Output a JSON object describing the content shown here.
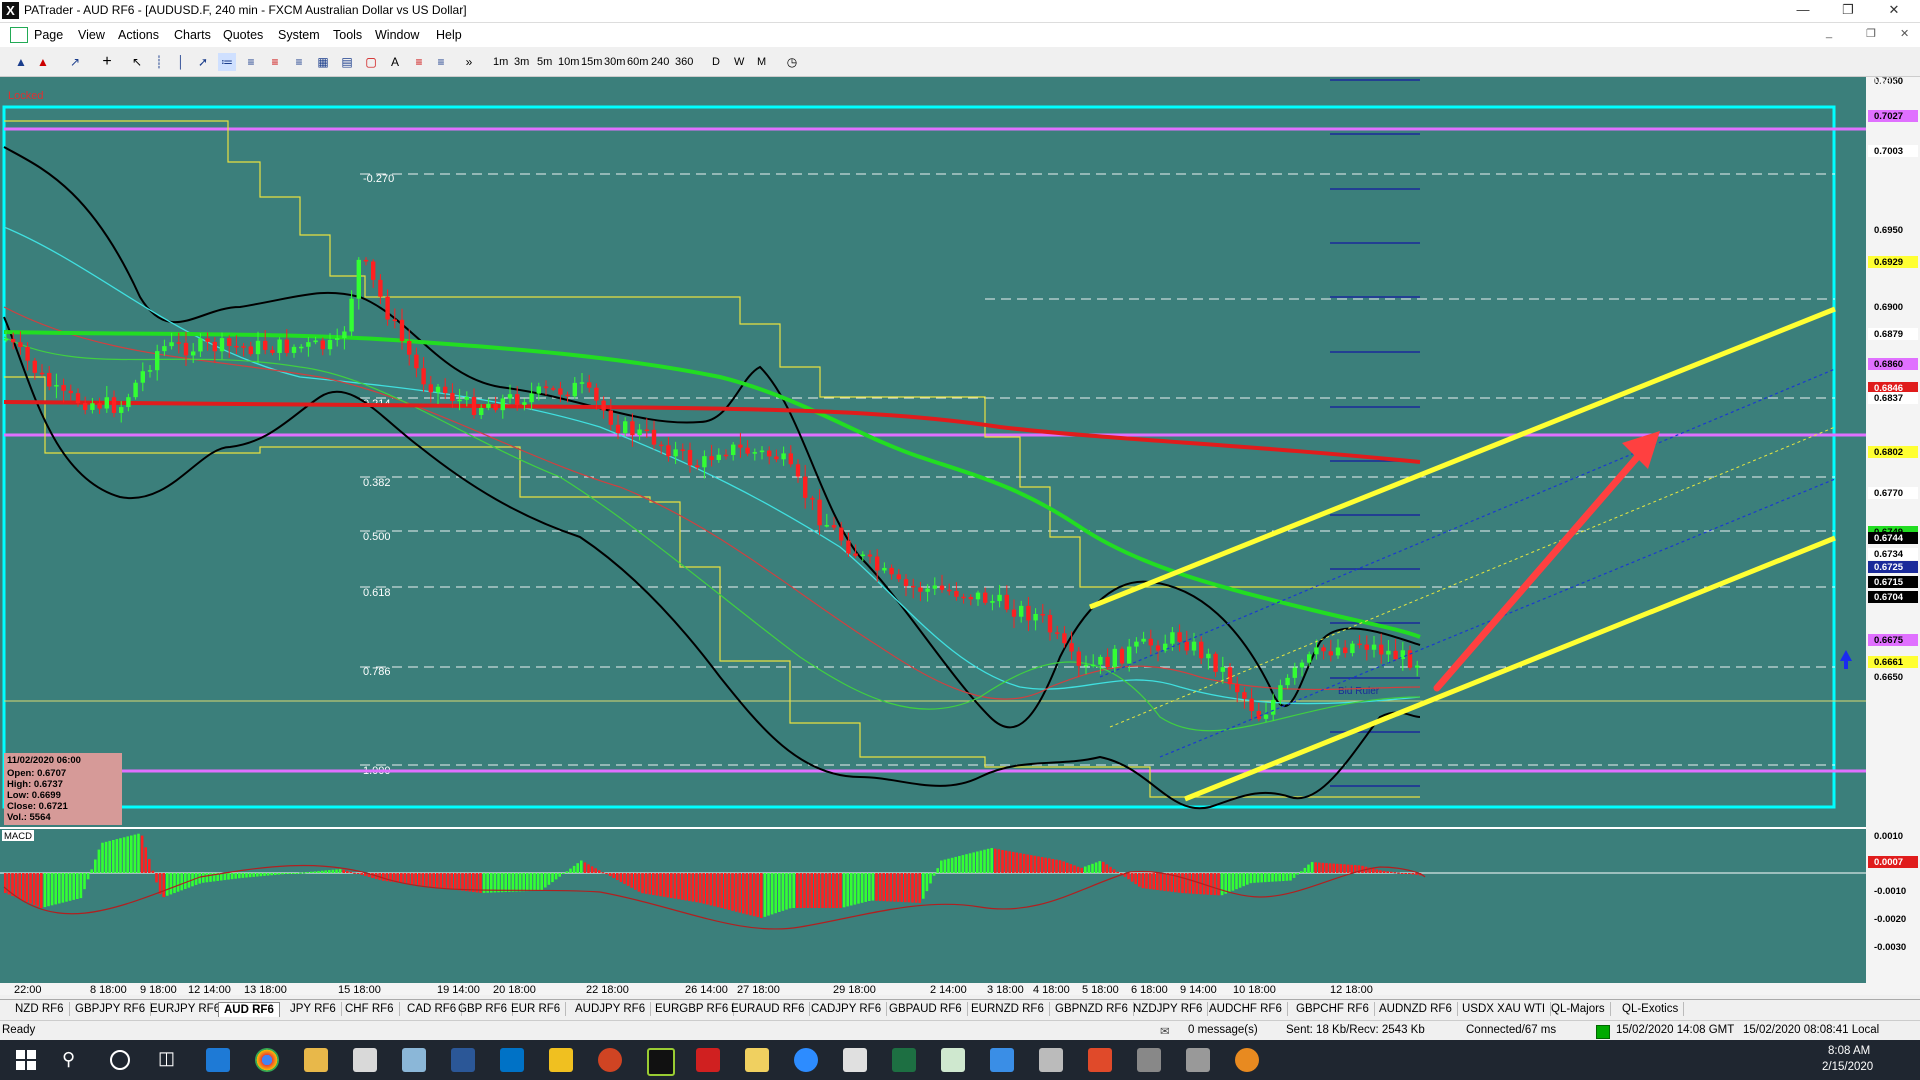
{
  "window": {
    "title": "PATrader - AUD RF6 - [AUDUSD.F, 240 min - FXCM Australian Dollar vs US Dollar]",
    "logo": "X"
  },
  "menu": [
    "Page",
    "View",
    "Actions",
    "Charts",
    "Quotes",
    "System",
    "Tools",
    "Window",
    "Help"
  ],
  "toolbar": {
    "timeframes": [
      "1m",
      "3m",
      "5m",
      "10m",
      "15m",
      "30m",
      "60m",
      "240",
      "360"
    ],
    "periods": [
      "D",
      "W",
      "M"
    ]
  },
  "chart": {
    "locked_label": "Locked",
    "index_label": "INDEX",
    "macd_label": "MACD",
    "fib_labels": [
      "-0.270",
      "0.214",
      "0.382",
      "0.500",
      "0.618",
      "0.786",
      "1.000"
    ],
    "price_labels": [
      "0.7050",
      "0.7027",
      "0.7003",
      "0.6950",
      "0.6929",
      "0.6900",
      "0.6879",
      "0.6860",
      "0.6846",
      "0.6837",
      "0.6802",
      "0.6770",
      "0.6749",
      "0.6744",
      "0.6734",
      "0.6725",
      "0.6715",
      "0.6704",
      "0.6675",
      "0.6661",
      "0.6650"
    ],
    "macd_labels": [
      "0.0010",
      "0.0007",
      "-0.0010",
      "-0.0020",
      "-0.0030"
    ],
    "time_labels": [
      "22:00",
      "8 18:00",
      "9 18:00",
      "12 14:00",
      "13 18:00",
      "15 18:00",
      "19 14:00",
      "20 18:00",
      "22 18:00",
      "26 14:00",
      "27 18:00",
      "29 18:00",
      "2 14:00",
      "3 18:00",
      "4 18:00",
      "5 18:00",
      "6 18:00",
      "9 14:00",
      "10 18:00",
      "12 18:00"
    ],
    "bid_label": "Bid Ruler",
    "ohlc": {
      "date": "11/02/2020 06:00",
      "open": "Open: 0.6707",
      "high": "High: 0.6737",
      "low": "Low: 0.6699",
      "close": "Close: 0.6721",
      "vol": "Vol.: 5564"
    },
    "colors": {
      "bg": "#3b7f7b",
      "bull": "#33ff33",
      "bear": "#ff2020",
      "cyan": "#00ffff",
      "magenta": "#e070ff",
      "yellow": "#ffff33",
      "red_arrow": "#ff4040"
    }
  },
  "tabs": [
    "NZD RF6",
    "GBPJPY RF6",
    "EURJPY RF6",
    "AUD RF6",
    "JPY RF6",
    "CHF RF6",
    "CAD RF6",
    "GBP RF6",
    "EUR RF6",
    "AUDJPY RF6",
    "EURGBP RF6",
    "EURAUD RF6",
    "CADJPY RF6",
    "GBPAUD RF6",
    "EURNZD RF6",
    "GBPNZD RF6",
    "NZDJPY RF6",
    "AUDCHF RF6",
    "GBPCHF RF6",
    "AUDNZD RF6",
    "USDX XAU WTI",
    "QL-Majors",
    "QL-Exotics"
  ],
  "active_tab": "AUD RF6",
  "status": {
    "ready": "Ready",
    "messages": "0 message(s)",
    "traffic": "Sent: 18 Kb/Recv: 2543 Kb",
    "connected": "Connected/67 ms",
    "gmt": "15/02/2020 14:08 GMT",
    "local": "15/02/2020 08:08:41 Local"
  },
  "taskbar": {
    "time": "8:08 AM",
    "date": "2/15/2020"
  }
}
